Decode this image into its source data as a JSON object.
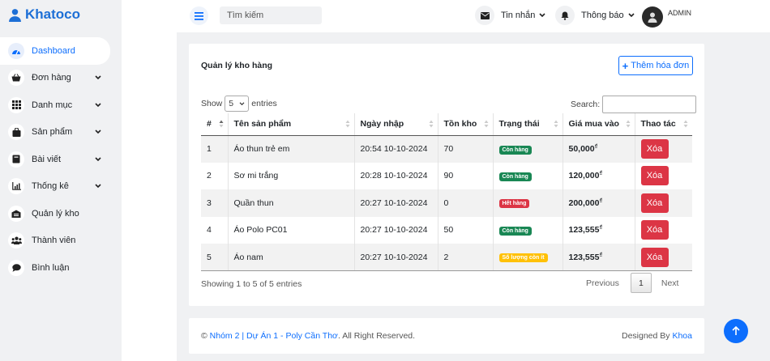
{
  "brand": {
    "name": "Khatoco"
  },
  "sidebar": {
    "items": [
      {
        "label": "Dashboard",
        "icon": "gauge-icon",
        "active": true,
        "expandable": false
      },
      {
        "label": "Đơn hàng",
        "icon": "basket-icon",
        "expandable": true
      },
      {
        "label": "Danh mục",
        "icon": "grid-icon",
        "expandable": true
      },
      {
        "label": "Sản phẩm",
        "icon": "bag-icon",
        "expandable": true
      },
      {
        "label": "Bài viết",
        "icon": "book-icon",
        "expandable": true
      },
      {
        "label": "Thống kê",
        "icon": "chart-icon",
        "expandable": true
      },
      {
        "label": "Quản lý kho",
        "icon": "warehouse-icon",
        "expandable": false
      },
      {
        "label": "Thành viên",
        "icon": "users-icon",
        "expandable": false
      },
      {
        "label": "Bình luận",
        "icon": "comment-icon",
        "expandable": false
      }
    ]
  },
  "topbar": {
    "search_placeholder": "Tìm kiếm",
    "messages_label": "Tin nhắn",
    "notifications_label": "Thông báo",
    "user_label": "ADMIN"
  },
  "card": {
    "title": "Quản lý kho hàng",
    "add_button": "Thêm hóa đơn",
    "show_label": "Show",
    "entries_value": "5",
    "entries_label": "entries",
    "search_label": "Search:"
  },
  "table": {
    "columns": [
      "#",
      "Tên sản phẩm",
      "Ngày nhập",
      "Tồn kho",
      "Trạng thái",
      "Giá mua vào",
      "Thao tác"
    ],
    "rows": [
      {
        "id": "1",
        "name": "Áo thun trẻ em",
        "date": "20:54 10-10-2024",
        "stock": "70",
        "status": "Còn hàng",
        "status_color": "#198754",
        "price": "50,000",
        "currency": "₫",
        "action": "Xóa"
      },
      {
        "id": "2",
        "name": "Sơ mi trắng",
        "date": "20:28 10-10-2024",
        "stock": "90",
        "status": "Còn hàng",
        "status_color": "#198754",
        "price": "120,000",
        "currency": "₫",
        "action": "Xóa"
      },
      {
        "id": "3",
        "name": "Quần thun",
        "date": "20:27 10-10-2024",
        "stock": "0",
        "status": "Hết hàng",
        "status_color": "#dc3545",
        "price": "200,000",
        "currency": "₫",
        "action": "Xóa"
      },
      {
        "id": "4",
        "name": "Áo Polo PC01",
        "date": "20:27 10-10-2024",
        "stock": "50",
        "status": "Còn hàng",
        "status_color": "#198754",
        "price": "123,555",
        "currency": "₫",
        "action": "Xóa"
      },
      {
        "id": "5",
        "name": "Áo nam",
        "date": "20:27 10-10-2024",
        "stock": "2",
        "status": "Số lượng còn ít",
        "status_color": "#ffc107",
        "price": "123,555",
        "currency": "₫",
        "action": "Xóa"
      }
    ]
  },
  "pagination": {
    "info": "Showing 1 to 5 of 5 entries",
    "prev": "Previous",
    "current": "1",
    "next": "Next"
  },
  "footer": {
    "prefix": "©",
    "link_text": "Nhóm 2 | Dự Án 1 - Poly Cần Thơ",
    "suffix": ". All Right Reserved.",
    "designed_by": "Designed By",
    "author": "Khoa"
  },
  "colors": {
    "primary": "#0d6efd",
    "danger": "#dc3545",
    "success": "#198754",
    "warning": "#ffc107"
  }
}
